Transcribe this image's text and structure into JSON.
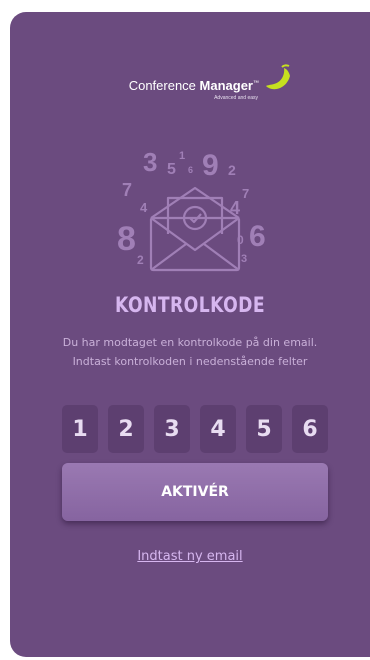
{
  "logo": {
    "brand_light": "Conference ",
    "brand_bold": "Manager",
    "trademark": "™",
    "tagline": "Advanced and easy"
  },
  "illustration": {
    "digits": [
      "3",
      "5",
      "1",
      "6",
      "9",
      "2",
      "7",
      "4",
      "4",
      "7",
      "8",
      "2",
      "0",
      "6",
      "3"
    ]
  },
  "page": {
    "title": "KONTROLKODE",
    "desc_line1": "Du har modtaget en kontrolkode på din email.",
    "desc_line2": "Indtast kontrolkoden i nedenstående felter"
  },
  "code": {
    "digits": [
      "1",
      "2",
      "3",
      "4",
      "5",
      "6"
    ]
  },
  "button": {
    "label": "AKTIVÉR"
  },
  "link": {
    "label": "Indtast ny email"
  },
  "colors": {
    "card_bg": "#6b4b7f",
    "accent": "#d6b6ef",
    "code_box": "#5d3f70",
    "button": "#8f6ea8",
    "logo_mark": "#c6df1f"
  }
}
